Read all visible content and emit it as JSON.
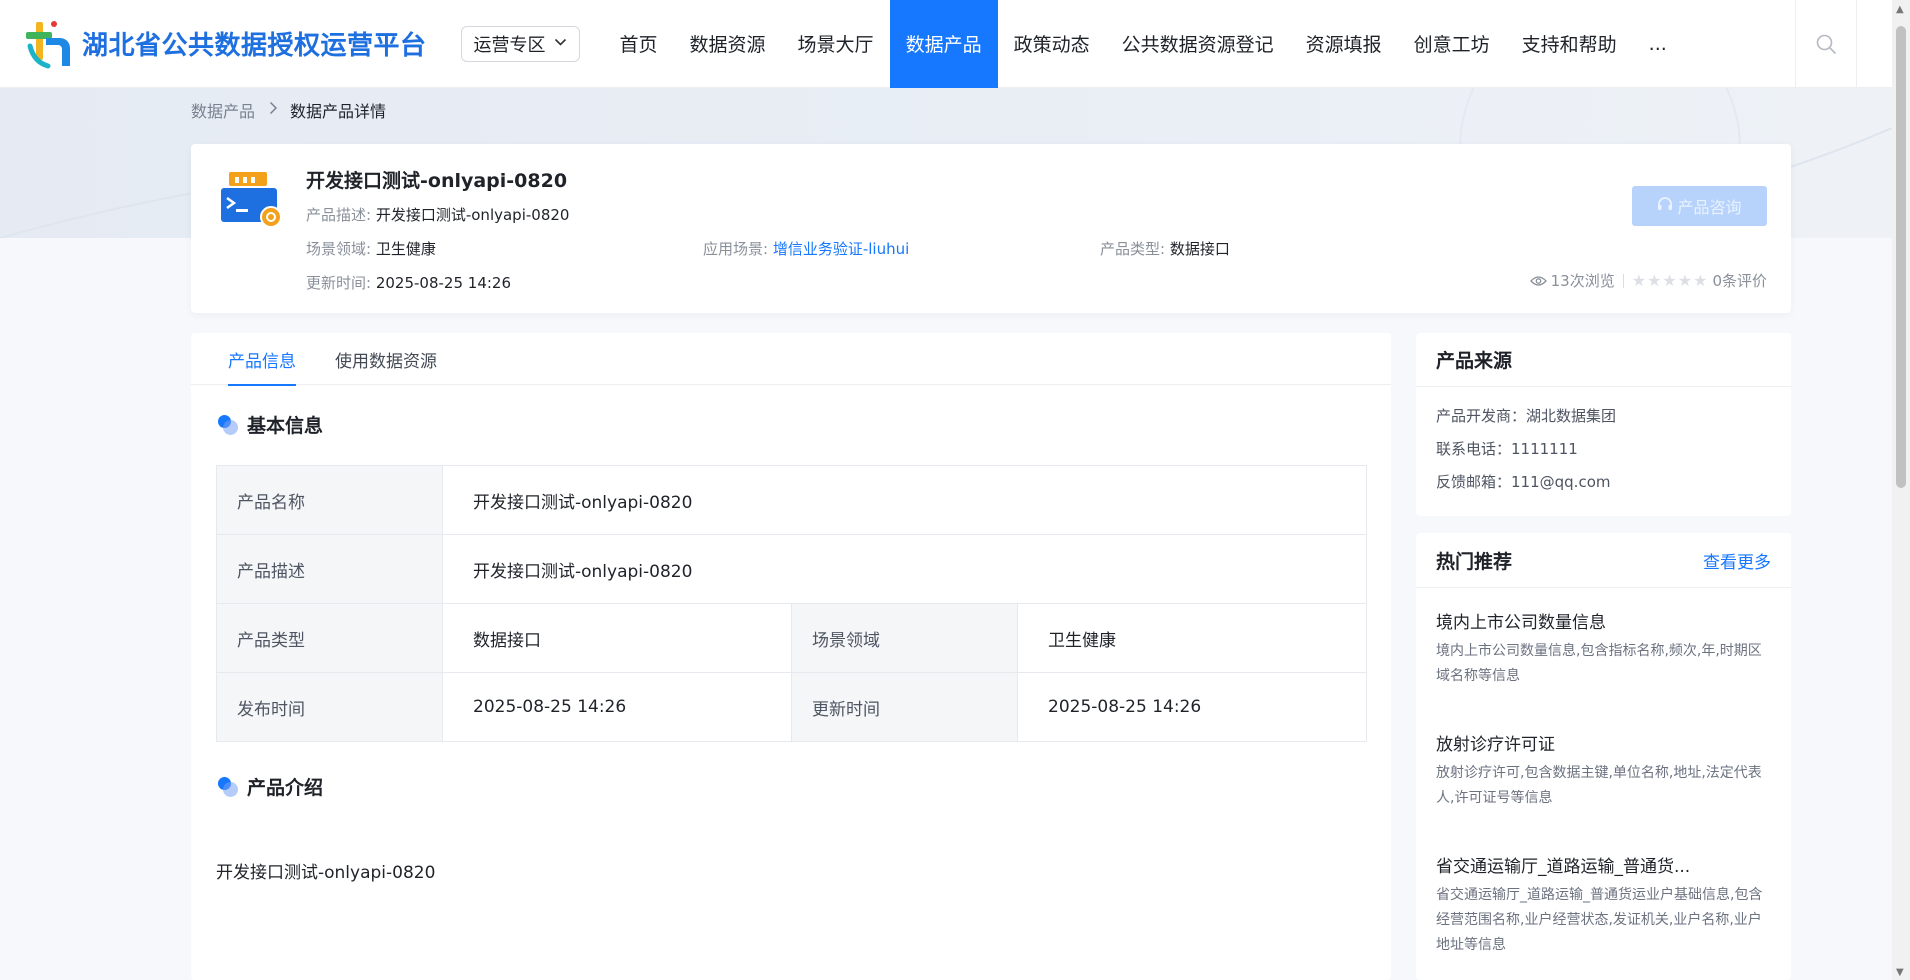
{
  "header": {
    "logo_text": "湖北省公共数据授权运营平台",
    "zone_select": "运营专区",
    "nav": [
      {
        "label": "首页",
        "active": false
      },
      {
        "label": "数据资源",
        "active": false
      },
      {
        "label": "场景大厅",
        "active": false
      },
      {
        "label": "数据产品",
        "active": true
      },
      {
        "label": "政策动态",
        "active": false
      },
      {
        "label": "公共数据资源登记",
        "active": false
      },
      {
        "label": "资源填报",
        "active": false
      },
      {
        "label": "创意工坊",
        "active": false
      },
      {
        "label": "支持和帮助",
        "active": false
      },
      {
        "label": "...",
        "active": false
      }
    ],
    "search_icon": "search-icon"
  },
  "breadcrumb": {
    "parent": "数据产品",
    "separator": ">",
    "current": "数据产品详情"
  },
  "product": {
    "title": "开发接口测试-onlyapi-0820",
    "desc_label": "产品描述:",
    "desc_value": "开发接口测试-onlyapi-0820",
    "field_label": "场景领域:",
    "field_value": "卫生健康",
    "scene_label": "应用场景:",
    "scene_value": "增信业务验证-liuhui",
    "type_label": "产品类型:",
    "type_value": "数据接口",
    "updated_label": "更新时间:",
    "updated_value": "2025-08-25 14:26",
    "consult_button": "产品咨询",
    "views": "13次浏览",
    "rating_stars": 0,
    "reviews": "0条评价"
  },
  "tabs": [
    {
      "label": "产品信息",
      "active": true
    },
    {
      "label": "使用数据资源",
      "active": false
    }
  ],
  "basic_info": {
    "title": "基本信息",
    "rows": [
      [
        {
          "label": "产品名称",
          "value": "开发接口测试-onlyapi-0820"
        }
      ],
      [
        {
          "label": "产品描述",
          "value": "开发接口测试-onlyapi-0820"
        }
      ],
      [
        {
          "label": "产品类型",
          "value": "数据接口"
        },
        {
          "label": "场景领域",
          "value": "卫生健康"
        }
      ],
      [
        {
          "label": "发布时间",
          "value": "2025-08-25 14:26"
        },
        {
          "label": "更新时间",
          "value": "2025-08-25 14:26"
        }
      ]
    ]
  },
  "intro": {
    "title": "产品介绍",
    "text": "开发接口测试-onlyapi-0820"
  },
  "source": {
    "title": "产品来源",
    "developer": "产品开发商：湖北数据集团",
    "phone": "联系电话：1111111",
    "email": "反馈邮箱：111@qq.com"
  },
  "hot": {
    "title": "热门推荐",
    "more": "查看更多",
    "items": [
      {
        "title": "境内上市公司数量信息",
        "desc": "境内上市公司数量信息,包含指标名称,频次,年,时期区域名称等信息"
      },
      {
        "title": "放射诊疗许可证",
        "desc": "放射诊疗许可,包含数据主键,单位名称,地址,法定代表人,许可证号等信息"
      },
      {
        "title": "省交通运输厅_道路运输_普通货...",
        "desc": "省交通运输厅_道路运输_普通货运业户基础信息,包含经营范围名称,业户经营状态,发证机关,业户名称,业户地址等信息"
      }
    ]
  },
  "colors": {
    "accent": "#1677ff",
    "consult_disabled": "#b7d3fb",
    "label_bg": "#f5f6f8"
  }
}
